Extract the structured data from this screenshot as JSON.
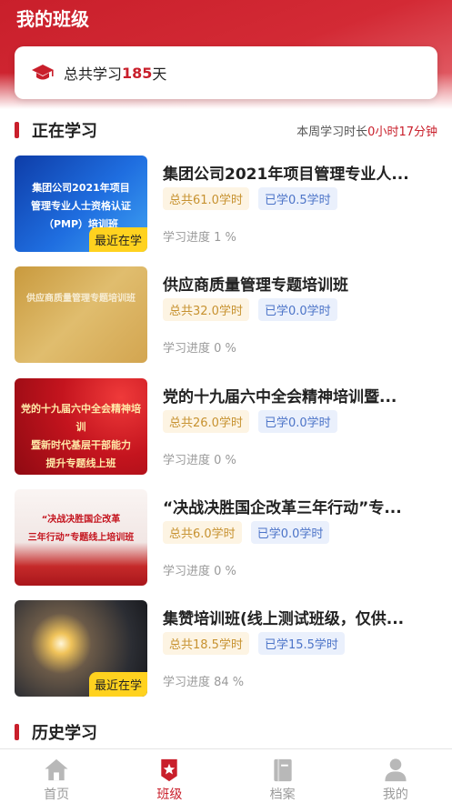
{
  "header": {
    "title": "我的班级"
  },
  "summary": {
    "prefix": "总共学习",
    "days": "185",
    "suffix": "天"
  },
  "current": {
    "title": "正在学习",
    "week_prefix": "本周学习时长",
    "week_value": "0小时17分钟"
  },
  "courses": [
    {
      "title": "集团公司2021年项目管理专业人...",
      "total": "总共61.0学时",
      "done": "已学0.5学时",
      "progress": "学习进度 1 %",
      "thumb_text": "集团公司2021年项目 管理专业人士资格认证 （PMP）培训班",
      "badge": "最近在学",
      "color": "#1f5fcf"
    },
    {
      "title": "供应商质量管理专题培训班",
      "total": "总共32.0学时",
      "done": "已学0.0学时",
      "progress": "学习进度 0 %",
      "thumb_text": "供应商质量管理专题培训班",
      "badge": "",
      "color": "#d7b05a"
    },
    {
      "title": "党的十九届六中全会精神培训暨...",
      "total": "总共26.0学时",
      "done": "已学0.0学时",
      "progress": "学习进度 0 %",
      "thumb_text": "党的十九届六中全会精神培训 暨新时代基层干部能力 提升专题线上班",
      "badge": "",
      "color": "#c4141e"
    },
    {
      "title": "“决战决胜国企改革三年行动”专...",
      "total": "总共6.0学时",
      "done": "已学0.0学时",
      "progress": "学习进度 0 %",
      "thumb_text": "“决战决胜国企改革 三年行动”专题线上培训班",
      "badge": "",
      "color": "#f3ecec"
    },
    {
      "title": "集赞培训班(线上测试班级，仅供...",
      "total": "总共18.5学时",
      "done": "已学15.5学时",
      "progress": "学习进度 84 %",
      "thumb_text": "",
      "badge": "最近在学",
      "color": "#3a3d44"
    }
  ],
  "history": {
    "title": "历史学习"
  },
  "tabs": [
    {
      "label": "首页",
      "icon": "home-icon",
      "active": false
    },
    {
      "label": "班级",
      "icon": "class-icon",
      "active": true
    },
    {
      "label": "档案",
      "icon": "archive-icon",
      "active": false
    },
    {
      "label": "我的",
      "icon": "user-icon",
      "active": false
    }
  ],
  "colors": {
    "accent": "#c91f2b",
    "badge": "#ffd21f"
  }
}
